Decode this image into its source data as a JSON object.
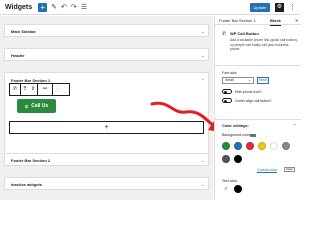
{
  "topbar": {
    "title": "Widgets",
    "add_glyph": "+",
    "edit_glyph": "✎",
    "undo_glyph": "↶",
    "redo_glyph": "↷",
    "list_glyph": "☰",
    "update_label": "Update",
    "settings_glyph": "⚙",
    "more_glyph": "⋮"
  },
  "canvas": {
    "areas": [
      {
        "title": "Main Sidebar",
        "chevron": "⌄"
      },
      {
        "title": "Header",
        "chevron": "⌄"
      },
      {
        "title": "Footer Bar Section 1",
        "chevron": "⌃"
      },
      {
        "title": "Footer Bar Section 2",
        "chevron": "⌄"
      },
      {
        "title": "Inactive widgets",
        "chevron": "⌄"
      }
    ],
    "block_toolbar": {
      "phone_glyph": "✆",
      "drag_glyph": "⠿",
      "move_glyph": "⇕",
      "link_glyph": "⚯",
      "more_glyph": "⋮"
    },
    "call_button": {
      "phone_glyph": "✆",
      "label": "Call Us"
    },
    "appender_glyph": "+"
  },
  "sidebar": {
    "tabs": [
      "Footer Bar Section 1",
      "Block"
    ],
    "active_tab": "Block",
    "close_glyph": "✕",
    "block": {
      "icon_glyph": "✆",
      "name": "WP Call Button",
      "description": "Add a clickable phone link (quick call button), so people can easily call your business phone."
    },
    "font_size": {
      "label": "Font size",
      "value": "Small",
      "caret": "⌄",
      "reset_label": "Reset"
    },
    "toggles": [
      {
        "label": "Hide phone icon?"
      },
      {
        "label": "Center align call button?"
      }
    ],
    "color_settings": {
      "title": "Color settings:",
      "chevron": "⌃",
      "background_label": "Background color",
      "background_indicator": "#2c8a3e",
      "swatches": [
        "#2c8a3e",
        "#1e73be",
        "#dd3333",
        "#f0c419",
        "#ffffff",
        "#888888",
        "#555555",
        "#000000"
      ],
      "custom_color_label": "Custom color",
      "clear_label": "Clear",
      "text_color_label": "Text color"
    }
  },
  "annotation": {
    "arrow_color": "#e02020"
  }
}
